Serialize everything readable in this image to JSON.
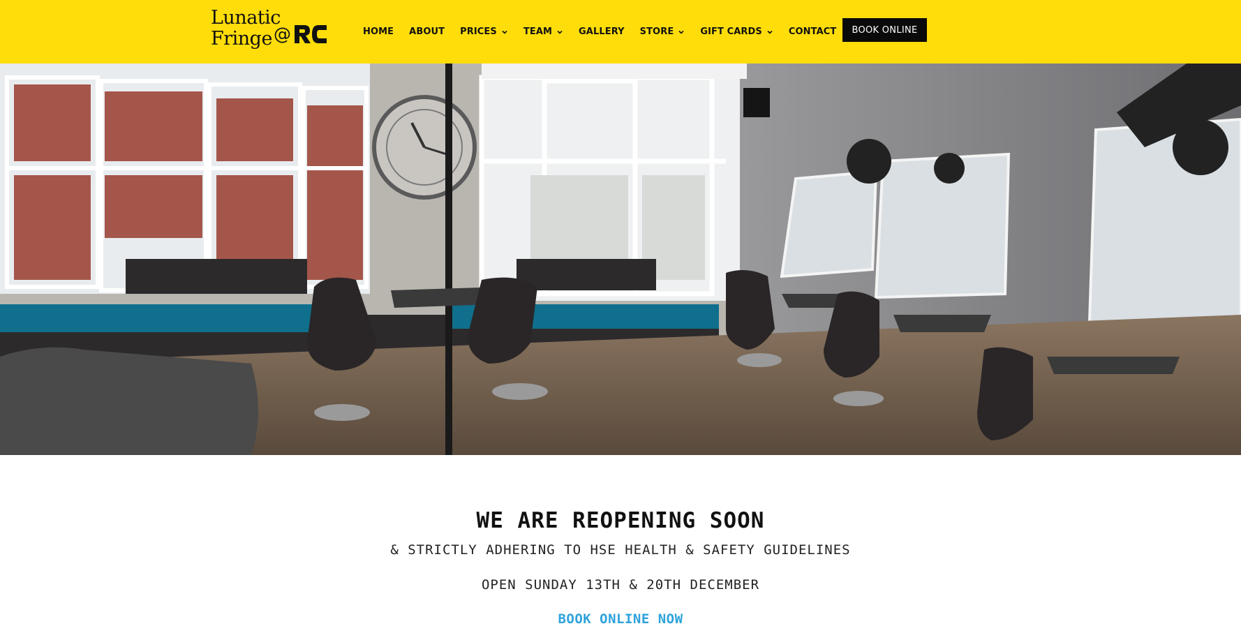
{
  "brand": {
    "logo_line1": "Lunatic",
    "logo_line2": "Fringe",
    "logo_at": "@",
    "logo_mark": "RC",
    "header_color": "#ffdd0a"
  },
  "nav": {
    "items": [
      {
        "label": "HOME",
        "has_dropdown": false
      },
      {
        "label": "ABOUT",
        "has_dropdown": false
      },
      {
        "label": "PRICES",
        "has_dropdown": true
      },
      {
        "label": "TEAM",
        "has_dropdown": true
      },
      {
        "label": "GALLERY",
        "has_dropdown": false
      },
      {
        "label": "STORE",
        "has_dropdown": true
      },
      {
        "label": "GIFT CARDS",
        "has_dropdown": true
      },
      {
        "label": "CONTACT",
        "has_dropdown": false
      }
    ],
    "chevron_icon": "chevron-down-icon"
  },
  "header_button": {
    "label": "BOOK ONLINE"
  },
  "hero": {
    "image": "salon-interior-photo"
  },
  "announcement": {
    "headline": "WE ARE REOPENING SOON",
    "subline1": "& STRICTLY ADHERING TO HSE HEALTH & SAFETY GUIDELINES",
    "subline2": "OPEN SUNDAY 13TH & 20TH DECEMBER",
    "cta": "BOOK ONLINE NOW",
    "cta_color": "#2ea3dc"
  }
}
